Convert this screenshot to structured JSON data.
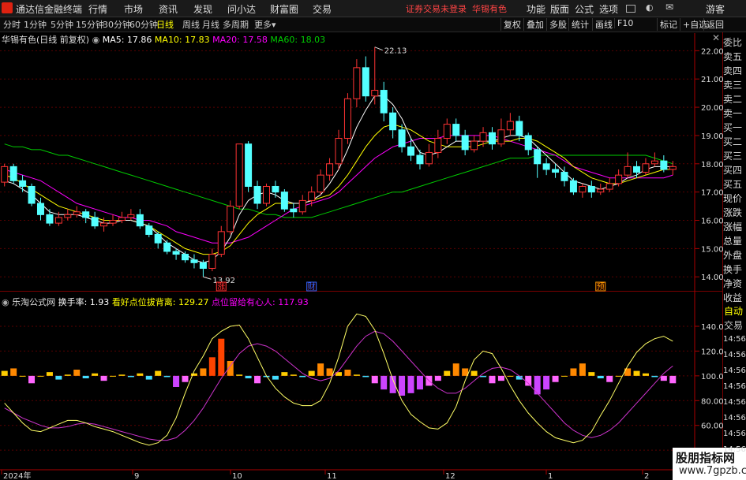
{
  "title_bar": {
    "app_title": "通达信金融终端",
    "menu": [
      "行情",
      "市场",
      "资讯",
      "发现",
      "问小达",
      "财富圈",
      "交易"
    ],
    "status": "证券交易未登录",
    "stock": "华锡有色",
    "right_menu": [
      "功能",
      "版面",
      "公式",
      "选项"
    ],
    "guest": "游客"
  },
  "period_bar": {
    "periods": [
      "分时",
      "1分钟",
      "5分钟",
      "15分钟",
      "30分钟",
      "60分钟",
      "日线",
      "周线",
      "月线",
      "多周期",
      "更多"
    ],
    "active": "日线",
    "tools": [
      "复权",
      "叠加",
      "多股",
      "统计",
      "画线",
      "F10",
      "标记",
      "+自选",
      "返回"
    ]
  },
  "main_panel": {
    "stock_label": "华锡有色(日线 前复权)",
    "ma5_label": "MA5: 17.86",
    "ma10_label": "MA10: 17.83",
    "ma20_label": "MA20: 17.58",
    "ma60_label": "MA60: 18.03",
    "high_label": "22.13",
    "low_label": "13.92",
    "markers": [
      "涨",
      "财",
      "预"
    ],
    "colors": {
      "ma5": "#ffffff",
      "ma10": "#ffff00",
      "ma20": "#ff00ff",
      "ma60": "#00cc00",
      "up": "#ff3333",
      "down": "#54ffff"
    }
  },
  "indicator_panel": {
    "name": "乐淘公式网",
    "turnover_label": "换手率: 1.93",
    "bull_label": "看好点位拔背离: 129.27",
    "main_label": "点位留给有心人: 117.93"
  },
  "side_panel": {
    "labels": [
      "委比",
      "卖五",
      "卖四",
      "卖三",
      "卖二",
      "卖一",
      "买一",
      "买二",
      "买三",
      "买四",
      "买五",
      "现价",
      "涨跌",
      "涨幅",
      "总量",
      "外盘",
      "换手",
      "净资",
      "收益"
    ],
    "auto_label": "自动",
    "trade_label": "交易",
    "times": [
      "14:56",
      "14:56",
      "14:56",
      "14:56",
      "14:56",
      "14:56",
      "14:56",
      "14:56"
    ]
  },
  "watermark": {
    "line1": "股朋指标网",
    "line2": "www.7gpzb.com"
  },
  "chart_data": {
    "type": "candlestick",
    "price_axis": {
      "ticks": [
        14.0,
        15.0,
        16.0,
        17.0,
        18.0,
        19.0,
        20.0,
        21.0,
        22.0
      ],
      "range": [
        13.7,
        22.4
      ]
    },
    "indicator_axis": {
      "ticks": [
        40.0,
        60.0,
        80.0,
        100.0,
        120.0,
        140.0
      ],
      "range": [
        28,
        154
      ]
    },
    "x_labels": [
      "2024年",
      "9",
      "10",
      "11",
      "12",
      "1",
      "2"
    ],
    "candles": [
      [
        17.35,
        17.9,
        17.2,
        18.0
      ],
      [
        17.9,
        17.4,
        17.3,
        18.0
      ],
      [
        17.4,
        17.2,
        17.0,
        17.6
      ],
      [
        17.2,
        16.6,
        16.5,
        17.3
      ],
      [
        16.6,
        16.2,
        16.0,
        16.8
      ],
      [
        16.2,
        15.9,
        15.8,
        16.4
      ],
      [
        15.9,
        16.1,
        15.8,
        16.3
      ],
      [
        16.1,
        16.2,
        16.0,
        16.4
      ],
      [
        16.2,
        16.3,
        16.1,
        16.5
      ],
      [
        16.3,
        16.1,
        15.9,
        16.4
      ],
      [
        16.1,
        15.8,
        15.7,
        16.3
      ],
      [
        15.8,
        15.9,
        15.6,
        16.1
      ],
      [
        15.9,
        16.0,
        15.8,
        16.2
      ],
      [
        16.0,
        16.1,
        15.9,
        16.3
      ],
      [
        16.1,
        16.2,
        16.0,
        16.4
      ],
      [
        16.2,
        15.8,
        15.7,
        16.4
      ],
      [
        15.8,
        15.5,
        15.4,
        15.9
      ],
      [
        15.5,
        15.2,
        15.0,
        15.6
      ],
      [
        15.2,
        14.9,
        14.8,
        15.3
      ],
      [
        14.9,
        14.8,
        14.6,
        15.0
      ],
      [
        14.8,
        14.6,
        14.5,
        14.9
      ],
      [
        14.6,
        14.5,
        14.3,
        14.8
      ],
      [
        14.5,
        14.3,
        14.0,
        14.6
      ],
      [
        14.3,
        14.8,
        14.2,
        15.0
      ],
      [
        14.8,
        15.6,
        14.7,
        15.8
      ],
      [
        15.6,
        16.5,
        15.5,
        16.7
      ],
      [
        16.5,
        18.7,
        16.4,
        18.7
      ],
      [
        18.7,
        17.2,
        17.0,
        18.8
      ],
      [
        17.2,
        16.6,
        16.4,
        17.4
      ],
      [
        16.6,
        17.2,
        16.5,
        17.3
      ],
      [
        17.2,
        17.0,
        16.8,
        17.4
      ],
      [
        17.0,
        16.4,
        16.3,
        17.1
      ],
      [
        16.4,
        16.3,
        16.1,
        16.6
      ],
      [
        16.3,
        16.7,
        16.2,
        16.9
      ],
      [
        16.7,
        17.0,
        16.5,
        17.2
      ],
      [
        17.0,
        17.6,
        16.9,
        17.8
      ],
      [
        17.6,
        18.0,
        17.4,
        18.2
      ],
      [
        18.0,
        18.9,
        17.8,
        19.2
      ],
      [
        18.9,
        20.3,
        18.7,
        20.5
      ],
      [
        20.3,
        21.4,
        20.0,
        21.7
      ],
      [
        21.4,
        20.4,
        20.2,
        21.8
      ],
      [
        20.4,
        20.6,
        20.1,
        22.13
      ],
      [
        20.6,
        19.8,
        19.5,
        20.9
      ],
      [
        19.8,
        19.2,
        18.9,
        20.0
      ],
      [
        19.2,
        18.6,
        18.4,
        19.4
      ],
      [
        18.6,
        18.3,
        18.1,
        18.9
      ],
      [
        18.3,
        18.0,
        17.8,
        18.5
      ],
      [
        18.0,
        18.4,
        17.9,
        18.7
      ],
      [
        18.4,
        18.9,
        18.2,
        19.2
      ],
      [
        18.9,
        19.4,
        18.7,
        19.6
      ],
      [
        19.4,
        19.0,
        18.8,
        19.6
      ],
      [
        19.0,
        18.5,
        18.3,
        19.2
      ],
      [
        18.5,
        18.8,
        18.4,
        19.0
      ],
      [
        18.8,
        19.1,
        18.6,
        19.3
      ],
      [
        19.1,
        18.7,
        18.5,
        19.3
      ],
      [
        18.7,
        19.2,
        18.6,
        19.6
      ],
      [
        19.2,
        19.5,
        19.0,
        19.8
      ],
      [
        19.5,
        19.0,
        18.8,
        19.7
      ],
      [
        19.0,
        18.5,
        18.3,
        19.1
      ],
      [
        18.5,
        18.0,
        17.5,
        18.6
      ],
      [
        18.0,
        17.8,
        17.6,
        18.2
      ],
      [
        17.8,
        17.7,
        17.5,
        18.0
      ],
      [
        17.7,
        17.4,
        17.2,
        17.9
      ],
      [
        17.4,
        17.0,
        16.9,
        17.5
      ],
      [
        17.0,
        17.2,
        16.8,
        17.3
      ],
      [
        17.2,
        17.0,
        16.8,
        17.4
      ],
      [
        17.0,
        17.1,
        16.9,
        17.3
      ],
      [
        17.1,
        17.3,
        17.0,
        17.5
      ],
      [
        17.3,
        17.6,
        17.2,
        17.8
      ],
      [
        17.6,
        17.9,
        17.5,
        18.4
      ],
      [
        17.9,
        17.7,
        17.5,
        18.1
      ],
      [
        17.7,
        18.0,
        17.6,
        18.2
      ],
      [
        18.0,
        18.1,
        17.9,
        18.4
      ],
      [
        18.1,
        17.8,
        17.7,
        18.3
      ],
      [
        17.8,
        17.9,
        17.6,
        18.1
      ]
    ],
    "ma5": [
      17.4,
      17.3,
      17.1,
      16.9,
      16.6,
      16.3,
      16.2,
      16.2,
      16.2,
      16.1,
      16.0,
      15.9,
      15.9,
      16.0,
      16.0,
      15.9,
      15.8,
      15.5,
      15.2,
      15.0,
      14.8,
      14.6,
      14.5,
      14.6,
      14.9,
      15.4,
      16.2,
      16.7,
      16.9,
      17.0,
      16.9,
      16.7,
      16.6,
      16.6,
      16.7,
      16.9,
      17.3,
      17.8,
      18.5,
      19.3,
      19.9,
      20.4,
      20.4,
      20.1,
      19.6,
      18.9,
      18.4,
      18.3,
      18.4,
      18.6,
      18.8,
      18.8,
      18.8,
      18.8,
      18.8,
      18.9,
      19.0,
      19.0,
      18.9,
      18.6,
      18.3,
      18.0,
      17.7,
      17.4,
      17.3,
      17.2,
      17.1,
      17.2,
      17.3,
      17.5,
      17.6,
      17.8,
      17.9,
      17.9,
      17.9
    ],
    "ma10": [
      17.6,
      17.5,
      17.3,
      17.1,
      16.9,
      16.7,
      16.5,
      16.4,
      16.3,
      16.2,
      16.1,
      16.0,
      16.0,
      16.0,
      16.0,
      15.9,
      15.8,
      15.6,
      15.4,
      15.2,
      15.0,
      14.9,
      14.8,
      14.8,
      14.9,
      15.1,
      15.5,
      15.9,
      16.2,
      16.4,
      16.6,
      16.6,
      16.6,
      16.6,
      16.7,
      16.8,
      16.9,
      17.2,
      17.6,
      18.1,
      18.6,
      19.0,
      19.3,
      19.4,
      19.3,
      19.2,
      19.0,
      18.8,
      18.7,
      18.6,
      18.6,
      18.6,
      18.6,
      18.7,
      18.8,
      18.8,
      18.8,
      18.9,
      18.9,
      18.8,
      18.6,
      18.4,
      18.2,
      17.9,
      17.7,
      17.5,
      17.4,
      17.3,
      17.3,
      17.4,
      17.5,
      17.6,
      17.7,
      17.8,
      17.8
    ],
    "ma20": [
      17.8,
      17.7,
      17.6,
      17.5,
      17.4,
      17.2,
      17.0,
      16.8,
      16.6,
      16.5,
      16.4,
      16.3,
      16.2,
      16.1,
      16.1,
      16.0,
      16.0,
      15.9,
      15.8,
      15.6,
      15.5,
      15.4,
      15.3,
      15.2,
      15.2,
      15.2,
      15.3,
      15.4,
      15.6,
      15.8,
      16.0,
      16.2,
      16.4,
      16.5,
      16.6,
      16.7,
      16.8,
      17.0,
      17.3,
      17.6,
      17.9,
      18.2,
      18.4,
      18.6,
      18.7,
      18.8,
      18.9,
      18.9,
      18.9,
      19.0,
      19.0,
      19.0,
      19.0,
      19.0,
      19.0,
      18.9,
      18.8,
      18.7,
      18.6,
      18.5,
      18.4,
      18.3,
      18.1,
      17.9,
      17.8,
      17.7,
      17.6,
      17.5,
      17.5,
      17.5,
      17.5,
      17.5,
      17.5,
      17.5,
      17.6
    ],
    "ma60": [
      18.7,
      18.6,
      18.6,
      18.5,
      18.5,
      18.4,
      18.3,
      18.3,
      18.2,
      18.1,
      18.0,
      17.9,
      17.8,
      17.7,
      17.6,
      17.5,
      17.4,
      17.3,
      17.2,
      17.1,
      17.0,
      16.9,
      16.8,
      16.7,
      16.6,
      16.5,
      16.4,
      16.4,
      16.3,
      16.2,
      16.2,
      16.1,
      16.1,
      16.1,
      16.1,
      16.2,
      16.3,
      16.4,
      16.5,
      16.6,
      16.7,
      16.8,
      16.9,
      17.0,
      17.0,
      17.1,
      17.2,
      17.3,
      17.4,
      17.5,
      17.6,
      17.7,
      17.8,
      17.9,
      18.0,
      18.1,
      18.2,
      18.2,
      18.2,
      18.3,
      18.3,
      18.3,
      18.3,
      18.3,
      18.3,
      18.3,
      18.3,
      18.3,
      18.3,
      18.3,
      18.3,
      18.3,
      18.2,
      18.1,
      18.0
    ],
    "indicator_bars": [
      104,
      106,
      100,
      94,
      100,
      103,
      97,
      101,
      105,
      98,
      102,
      96,
      100,
      101,
      99,
      102,
      97,
      104,
      99,
      91,
      95,
      102,
      106,
      115,
      130,
      112,
      101,
      98,
      94,
      99,
      97,
      103,
      101,
      99,
      104,
      110,
      106,
      103,
      105,
      101,
      99,
      94,
      89,
      86,
      84,
      86,
      89,
      92,
      96,
      104,
      110,
      106,
      104,
      99,
      94,
      96,
      100,
      97,
      92,
      85,
      89,
      95,
      100,
      106,
      110,
      103,
      98,
      95,
      100,
      106,
      104,
      102,
      99,
      96,
      94
    ],
    "indicator_line_yellow": [
      78,
      70,
      62,
      56,
      55,
      58,
      61,
      64,
      64,
      62,
      59,
      57,
      55,
      52,
      49,
      46,
      44,
      46,
      52,
      66,
      86,
      104,
      116,
      130,
      136,
      140,
      141,
      130,
      115,
      100,
      90,
      83,
      78,
      76,
      76,
      80,
      94,
      115,
      140,
      150,
      148,
      137,
      118,
      97,
      80,
      69,
      63,
      58,
      57,
      62,
      75,
      96,
      113,
      120,
      118,
      106,
      92,
      80,
      70,
      62,
      55,
      50,
      48,
      46,
      48,
      55,
      68,
      80,
      94,
      108,
      119,
      126,
      130,
      132,
      128
    ],
    "indicator_line_purple": [
      74,
      70,
      66,
      63,
      60,
      58,
      58,
      59,
      61,
      62,
      61,
      59,
      57,
      55,
      53,
      51,
      49,
      48,
      48,
      50,
      56,
      64,
      74,
      86,
      98,
      108,
      118,
      124,
      126,
      124,
      120,
      114,
      108,
      102,
      98,
      96,
      98,
      104,
      114,
      124,
      132,
      136,
      134,
      128,
      120,
      112,
      104,
      96,
      90,
      86,
      86,
      90,
      96,
      102,
      106,
      107,
      105,
      100,
      94,
      86,
      78,
      70,
      62,
      56,
      52,
      50,
      52,
      56,
      62,
      70,
      78,
      86,
      94,
      102,
      108
    ]
  }
}
